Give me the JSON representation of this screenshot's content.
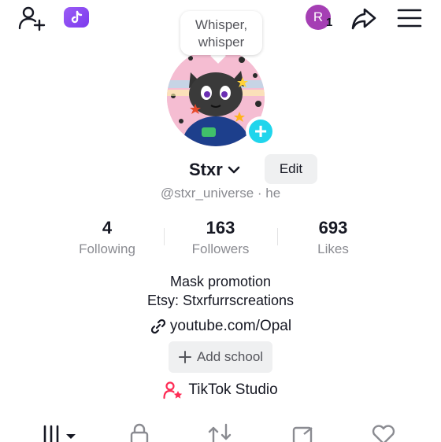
{
  "topbar": {
    "add_friend_icon": "add-friend-icon",
    "creator_badge_icon": "tiktok-ticket-icon",
    "avatar_initial": "R",
    "avatar_count": "1",
    "share_icon": "share-icon",
    "menu_icon": "hamburger-menu-icon"
  },
  "profile": {
    "bubble_text": "Whisper, whisper",
    "username": "Stxr",
    "edit_label": "Edit",
    "handle": "@stxr_universe · he"
  },
  "stats": [
    {
      "value": "4",
      "label": "Following"
    },
    {
      "value": "163",
      "label": "Followers"
    },
    {
      "value": "693",
      "label": "Likes"
    }
  ],
  "bio": {
    "line1": "Mask promotion",
    "line2": "Etsy: Stxrfurrscreations",
    "link": "youtube.com/Opal",
    "add_school": "Add school",
    "studio": "TikTok Studio"
  },
  "tabs": [
    "videos-grid-icon",
    "lock-icon",
    "repost-icon",
    "bookmark-icon",
    "liked-icon"
  ],
  "colors": {
    "accent_cyan": "#20d5ec",
    "studio_pink": "#fe2c55",
    "avatar_purple": "#a53fb4",
    "badge_purple": "#7c3aed"
  }
}
